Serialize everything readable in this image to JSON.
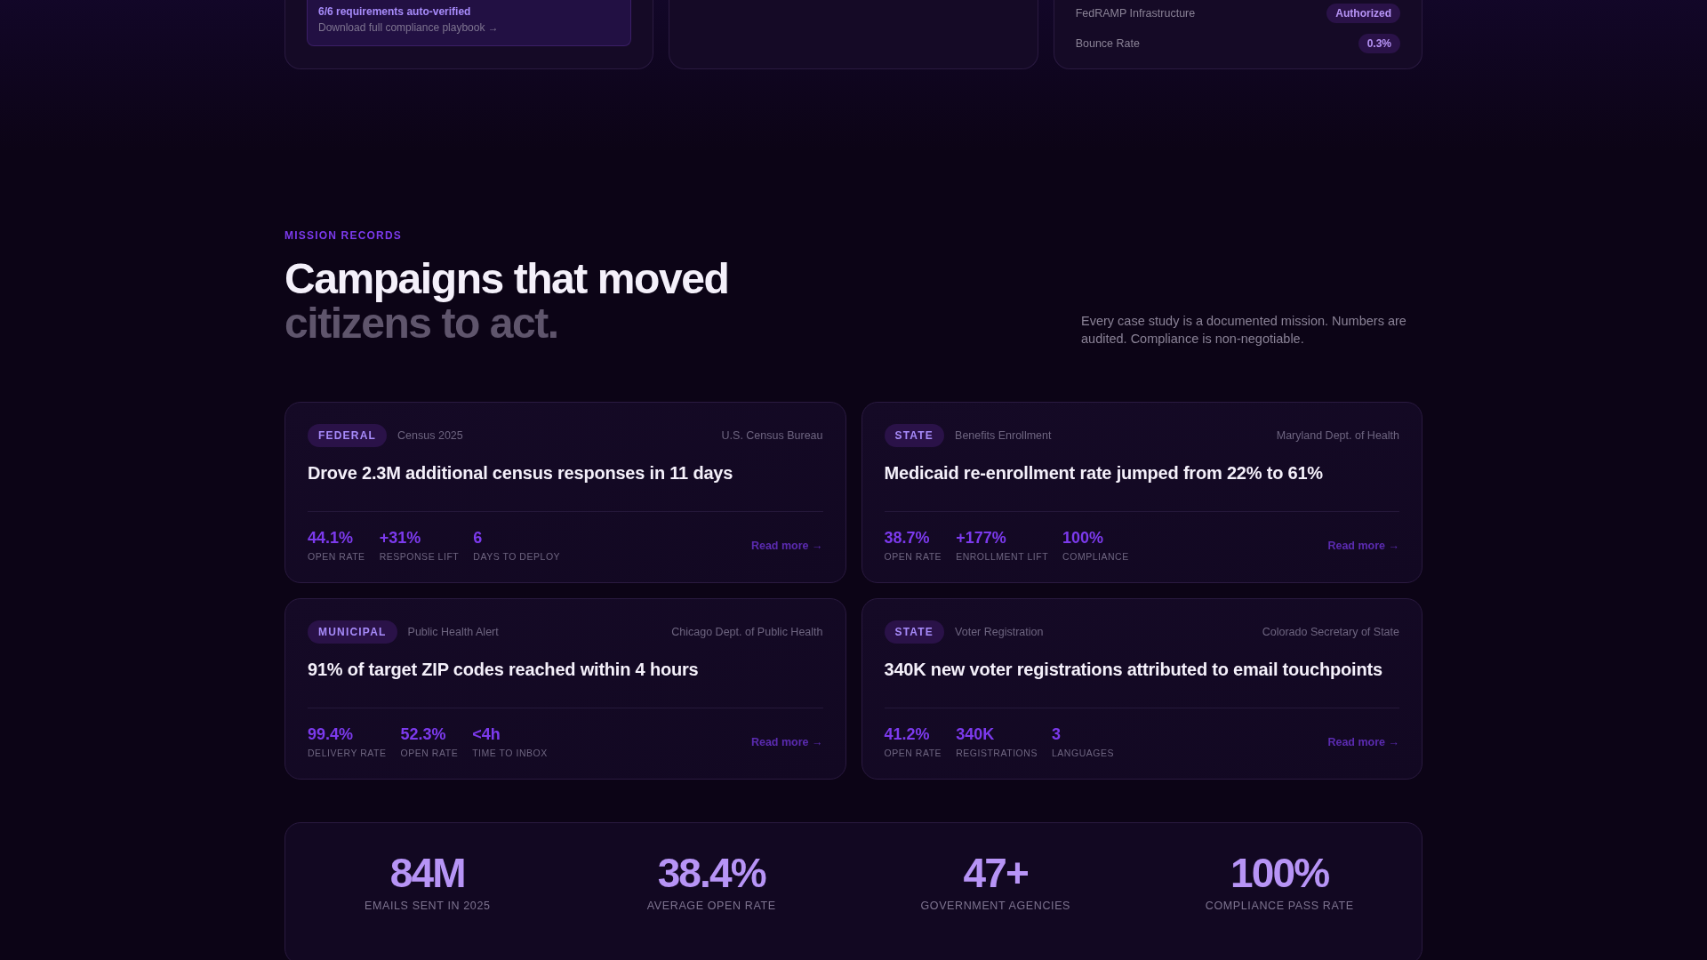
{
  "top_cards": [
    {
      "kind": "verify",
      "verified": "6/6 requirements auto-verified",
      "link": "Download full compliance playbook →"
    },
    {
      "kind": "blank"
    },
    {
      "kind": "rows",
      "rows": [
        {
          "label": "FedRAMP Infrastructure",
          "value": "Authorized"
        },
        {
          "label": "Bounce Rate",
          "value": "0.3%"
        }
      ]
    }
  ],
  "section": {
    "eyebrow": "MISSION RECORDS",
    "heading_line1": "Campaigns that moved",
    "heading_line2": "citizens to act.",
    "description": "Every case study is a documented mission. Numbers are audited. Compliance is non-negotiable."
  },
  "cases": [
    {
      "tag": "FEDERAL",
      "program": "Census 2025",
      "agency": "U.S. Census Bureau",
      "title": "Drove 2.3M additional census responses in 11 days",
      "stats": [
        {
          "value": "44.1%",
          "label": "OPEN RATE"
        },
        {
          "value": "+31%",
          "label": "RESPONSE LIFT"
        },
        {
          "value": "6",
          "label": "DAYS TO DEPLOY"
        }
      ],
      "link": "Read more →"
    },
    {
      "tag": "STATE",
      "program": "Benefits Enrollment",
      "agency": "Maryland Dept. of Health",
      "title": "Medicaid re-enrollment rate jumped from 22% to 61%",
      "stats": [
        {
          "value": "38.7%",
          "label": "OPEN RATE"
        },
        {
          "value": "+177%",
          "label": "ENROLLMENT LIFT"
        },
        {
          "value": "100%",
          "label": "COMPLIANCE"
        }
      ],
      "link": "Read more →"
    },
    {
      "tag": "MUNICIPAL",
      "program": "Public Health Alert",
      "agency": "Chicago Dept. of Public Health",
      "title": "91% of target ZIP codes reached within 4 hours",
      "stats": [
        {
          "value": "99.4%",
          "label": "DELIVERY RATE"
        },
        {
          "value": "52.3%",
          "label": "OPEN RATE"
        },
        {
          "value": "<4h",
          "label": "TIME TO INBOX"
        }
      ],
      "link": "Read more →"
    },
    {
      "tag": "STATE",
      "program": "Voter Registration",
      "agency": "Colorado Secretary of State",
      "title": "340K new voter registrations attributed to email touchpoints",
      "stats": [
        {
          "value": "41.2%",
          "label": "OPEN RATE"
        },
        {
          "value": "340K",
          "label": "REGISTRATIONS"
        },
        {
          "value": "3",
          "label": "LANGUAGES"
        }
      ],
      "link": "Read more →"
    }
  ],
  "totals": [
    {
      "value": "84M",
      "label": "EMAILS SENT IN 2025"
    },
    {
      "value": "38.4%",
      "label": "AVERAGE OPEN RATE"
    },
    {
      "value": "47+",
      "label": "GOVERNMENT AGENCIES"
    },
    {
      "value": "100%",
      "label": "COMPLIANCE PASS RATE"
    }
  ]
}
